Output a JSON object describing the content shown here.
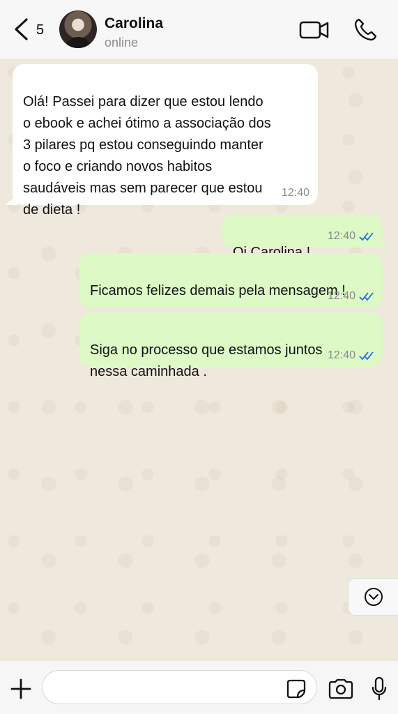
{
  "header": {
    "back_count": "5",
    "contact_name": "Carolina",
    "status": "online"
  },
  "messages": [
    {
      "direction": "incoming",
      "text": "Olá! Passei para dizer que estou lendo\no ebook e achei ótimo  a associação dos\n3 pilares pq estou conseguindo  manter\no foco e criando  novos habitos\nsaudáveis mas sem parecer  que estou\nde dieta !",
      "time": "12:40"
    },
    {
      "direction": "outgoing",
      "text": "Oi Carolina !",
      "time": "12:40",
      "status_icon": "double-check-icon"
    },
    {
      "direction": "outgoing",
      "text": "Ficamos felizes demais  pela mensagem !",
      "time": "12:40",
      "status_icon": "double-check-icon"
    },
    {
      "direction": "outgoing",
      "text": "Siga no processo  que estamos  juntos\nnessa caminhada .",
      "time": "12:40",
      "status_icon": "double-check-icon"
    }
  ],
  "composer": {
    "value": "",
    "placeholder": ""
  },
  "icons": {
    "back": "chevron-left-icon",
    "video": "video-call-icon",
    "call": "phone-icon",
    "scroll": "chevron-down-circle-icon",
    "attach": "plus-icon",
    "sticker": "sticker-icon",
    "camera": "camera-icon",
    "mic": "microphone-icon"
  },
  "colors": {
    "incoming_bubble": "#ffffff",
    "outgoing_bubble": "#dcf9c6",
    "read_ticks": "#1f6fe8",
    "chat_background": "#efe8dc"
  }
}
